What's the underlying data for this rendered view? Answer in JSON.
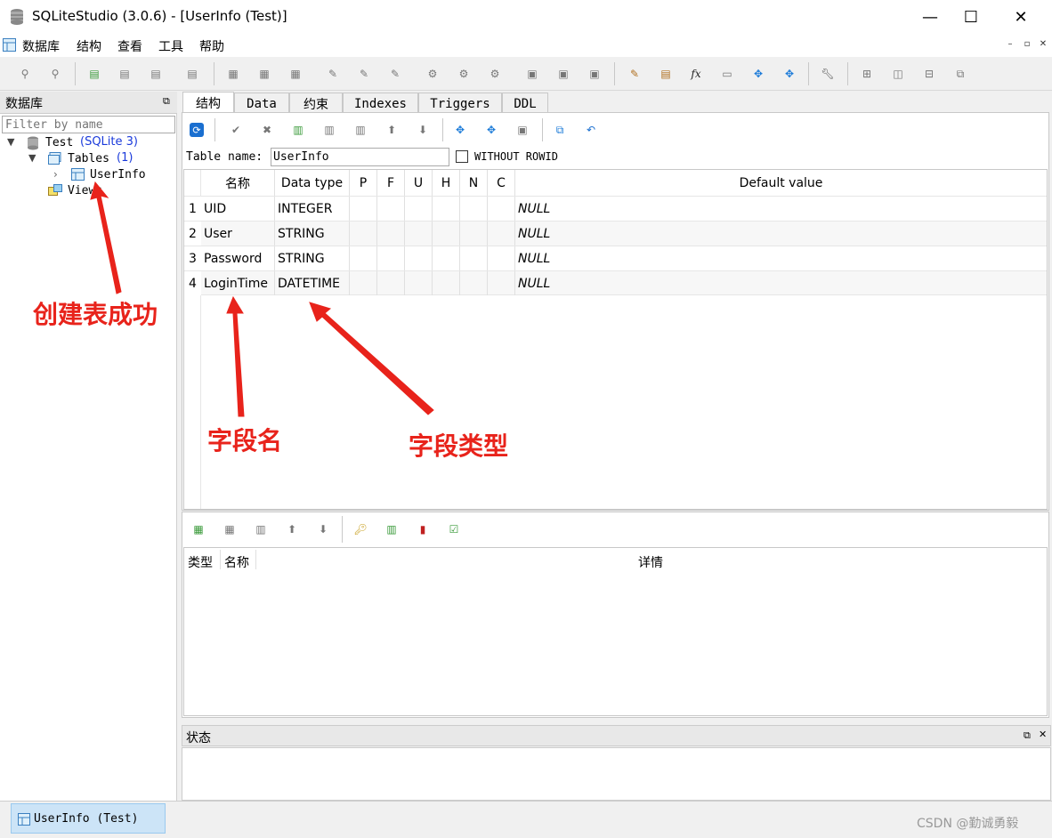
{
  "window": {
    "title": "SQLiteStudio (3.0.6) - [UserInfo (Test)]"
  },
  "menu": [
    "数据库",
    "结构",
    "查看",
    "工具",
    "帮助"
  ],
  "db_panel": {
    "title": "数据库",
    "filter_placeholder": "Filter by name",
    "tree": {
      "db_name": "Test",
      "db_version": "(SQLite 3)",
      "tables_label": "Tables",
      "tables_count": "(1)",
      "table_item": "UserInfo",
      "views_label": "Views"
    }
  },
  "tabs": [
    "结构",
    "Data",
    "约束",
    "Indexes",
    "Triggers",
    "DDL"
  ],
  "editor": {
    "table_name_label": "Table name:",
    "table_name_value": "UserInfo",
    "without_rowid_label": "WITHOUT ROWID",
    "columns_header": [
      "名称",
      "Data type",
      "P",
      "F",
      "U",
      "H",
      "N",
      "C",
      "Default value"
    ],
    "rows": [
      {
        "num": "1",
        "name": "UID",
        "type": "INTEGER",
        "default": "NULL"
      },
      {
        "num": "2",
        "name": "User",
        "type": "STRING",
        "default": "NULL"
      },
      {
        "num": "3",
        "name": "Password",
        "type": "STRING",
        "default": "NULL"
      },
      {
        "num": "4",
        "name": "LoginTime",
        "type": "DATETIME",
        "default": "NULL"
      }
    ]
  },
  "constraints": {
    "headers": [
      "类型",
      "名称",
      "详情"
    ]
  },
  "status": {
    "title": "状态"
  },
  "taskbar": {
    "window_item": "UserInfo (Test)"
  },
  "annotations": {
    "created": "创建表成功",
    "field_name": "字段名",
    "field_type": "字段类型"
  },
  "watermark": "CSDN @勤诚勇毅",
  "colors": {
    "annotation": "#e8231b",
    "db_version": "#1a3adb",
    "selected_item": "#cce4f7"
  }
}
